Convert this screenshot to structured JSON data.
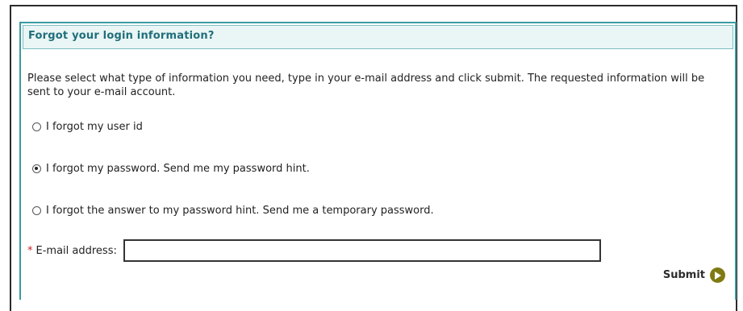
{
  "panel": {
    "title": "Forgot your login information?",
    "instructions": "Please select what type of information you need, type in your e-mail address and click submit. The requested information will be sent to your e-mail account."
  },
  "options": [
    {
      "label": "I forgot my user id",
      "checked": false
    },
    {
      "label": "I forgot my password. Send me my password hint.",
      "checked": true
    },
    {
      "label": "I forgot the answer to my password hint. Send me a temporary password.",
      "checked": false
    }
  ],
  "email": {
    "required_marker": "*",
    "label": "E-mail address:",
    "value": ""
  },
  "submit": {
    "label": "Submit",
    "icon": "play-arrow-icon"
  },
  "colors": {
    "accent_border": "#3a9aa0",
    "header_text": "#1f6f7a",
    "header_bg": "#eaf5f5",
    "required": "#cc1f1f",
    "submit_icon": "#7f7a12"
  }
}
